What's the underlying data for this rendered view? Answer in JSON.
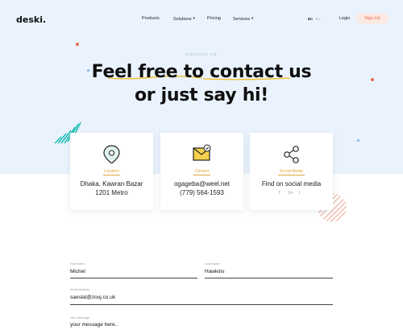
{
  "brand": {
    "logo": "deski."
  },
  "nav": {
    "items": [
      {
        "label": "Products",
        "has_caret": false
      },
      {
        "label": "Solutions",
        "has_caret": true
      },
      {
        "label": "Pricing",
        "has_caret": false
      },
      {
        "label": "Services",
        "has_caret": true
      }
    ],
    "languages": [
      "En",
      "Ru"
    ],
    "login": "Login",
    "signup": "Sign Up"
  },
  "hero": {
    "kicker": "CONTACT US",
    "line1": "Feel free to contact us",
    "line2": "or just say hi!"
  },
  "cards": {
    "location": {
      "label": "Location",
      "lines": [
        "Dhaka, Kawran Bazar",
        "1201 Metro"
      ]
    },
    "contact": {
      "label": "Contact",
      "lines": [
        "ogageba@weel.net",
        "(779) 564-1593"
      ]
    },
    "social": {
      "label": "Social Media",
      "lines": [
        "Find on social media"
      ],
      "icons": [
        "f",
        "G+",
        "t"
      ]
    }
  },
  "form": {
    "first_name": {
      "label": "First Name",
      "value": "Michel"
    },
    "last_name": {
      "label": "Last Name",
      "value": "Hawkins"
    },
    "email": {
      "label": "Email Address",
      "value": "saeslal@zouj.co.uk"
    },
    "message": {
      "label": "Your Message",
      "value": "your message here.."
    }
  },
  "colors": {
    "hero_bg": "#eaf3fd",
    "accent": "#e0a33a",
    "signup_text": "#ec6a4c",
    "teal": "#1bbdb0"
  }
}
